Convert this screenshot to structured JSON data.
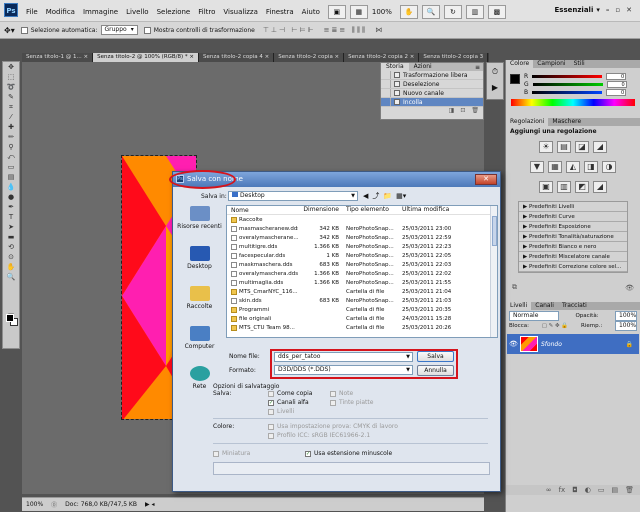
{
  "app": {
    "logo": "Ps",
    "menu": [
      "File",
      "Modifica",
      "Immagine",
      "Livello",
      "Selezione",
      "Filtro",
      "Visualizza",
      "Finestra",
      "Aiuto"
    ],
    "zoom": "100%",
    "workspace": "Essenziali",
    "window_controls": [
      "–",
      "▫",
      "✕"
    ]
  },
  "options_bar": {
    "auto_select_label": "Selezione automatica:",
    "auto_select_value": "Gruppo",
    "transform_label": "Mostra controlli di trasformazione"
  },
  "tabs": [
    {
      "label": "Senza titolo-1 @ 1... ×",
      "active": false
    },
    {
      "label": "Senza titolo-2 @ 100% (RGB/8) * ×",
      "active": true
    },
    {
      "label": "Senza titolo-2 copia 4 ×",
      "active": false
    },
    {
      "label": "Senza titolo-2 copia ×",
      "active": false
    },
    {
      "label": "Senza titolo-2 copia 2 ×",
      "active": false
    },
    {
      "label": "Senza titolo-2 copia 3",
      "active": false
    }
  ],
  "history_panel": {
    "tabs": [
      "Storia",
      "Azioni"
    ],
    "items": [
      {
        "label": "Trasformazione libera",
        "active": false
      },
      {
        "label": "Deselezione",
        "active": false
      },
      {
        "label": "Nuovo canale",
        "active": false
      },
      {
        "label": "Incolla",
        "active": true
      }
    ]
  },
  "color_panel": {
    "tabs": [
      "Colore",
      "Campioni",
      "Stili"
    ],
    "channels": [
      {
        "label": "R",
        "value": "0",
        "color": "#ff0000"
      },
      {
        "label": "G",
        "value": "0",
        "color": "#00c000"
      },
      {
        "label": "B",
        "value": "0",
        "color": "#0040ff"
      }
    ]
  },
  "adjustments_panel": {
    "tabs": [
      "Regolazioni",
      "Maschere"
    ],
    "title": "Aggiungi una regolazione",
    "icon_rows": [
      [
        "☀",
        "▤",
        "◪",
        "◢"
      ],
      [
        "▼",
        "▦",
        "◭",
        "◨",
        "◑"
      ],
      [
        "▣",
        "▥",
        "◩",
        "◢"
      ]
    ],
    "presets": [
      "Predefiniti Livelli",
      "Predefiniti Curve",
      "Predefiniti Esposizione",
      "Predefiniti Tonalità/saturazione",
      "Predefiniti Bianco e nero",
      "Predefiniti Miscelatore canale",
      "Predefiniti Correzione colore sel..."
    ]
  },
  "layers_panel": {
    "tabs": [
      "Livelli",
      "Canali",
      "Tracciati"
    ],
    "blend_mode": "Normale",
    "opacity_label": "Opacità:",
    "opacity": "100%",
    "lock_label": "Blocca:",
    "fill_label": "Riemp.:",
    "fill": "100%",
    "layers": [
      {
        "name": "Sfondo",
        "visible": true
      }
    ],
    "footer_icons": [
      "∞",
      "fx",
      "◘",
      "◐",
      "▭",
      "▤",
      "🗑"
    ]
  },
  "statusbar": {
    "zoom": "100%",
    "doc": "Doc: 768,0 KB/747,5 KB"
  },
  "dialog": {
    "title": "Salva con nome",
    "save_in_label": "Salva in:",
    "save_in_value": "Desktop",
    "places": [
      "Risorse recenti",
      "Desktop",
      "Raccolte",
      "Computer",
      "Rete"
    ],
    "columns": [
      "Nome",
      "Dimensione",
      "Tipo elemento",
      "Ultima modifica"
    ],
    "files": [
      {
        "name": "Raccolte",
        "size": "",
        "type": "",
        "date": "",
        "folder": true
      },
      {
        "name": "masmascheranew.dds",
        "size": "342 KB",
        "type": "NeroPhotoSnap...",
        "date": "25/03/2011 23:00",
        "folder": false
      },
      {
        "name": "overalymascherane...",
        "size": "342 KB",
        "type": "NeroPhotoSnap...",
        "date": "25/03/2011 22:59",
        "folder": false
      },
      {
        "name": "multitigre.dds",
        "size": "1.366 KB",
        "type": "NeroPhotoSnap...",
        "date": "25/03/2011 22:23",
        "folder": false
      },
      {
        "name": "facespecular.dds",
        "size": "1 KB",
        "type": "NeroPhotoSnap...",
        "date": "25/03/2011 22:05",
        "folder": false
      },
      {
        "name": "maskmaschera.dds",
        "size": "683 KB",
        "type": "NeroPhotoSnap...",
        "date": "25/03/2011 22:03",
        "folder": false
      },
      {
        "name": "overalymaschera.dds",
        "size": "1.366 KB",
        "type": "NeroPhotoSnap...",
        "date": "25/03/2011 22:02",
        "folder": false
      },
      {
        "name": "multimaglia.dds",
        "size": "1.366 KB",
        "type": "NeroPhotoSnap...",
        "date": "25/03/2011 21:55",
        "folder": false
      },
      {
        "name": "MTS_CmarNYC_116...",
        "size": "",
        "type": "Cartella di file",
        "date": "25/03/2011 21:04",
        "folder": true
      },
      {
        "name": "skin.dds",
        "size": "683 KB",
        "type": "NeroPhotoSnap...",
        "date": "25/03/2011 21:03",
        "folder": false
      },
      {
        "name": "Programmi",
        "size": "",
        "type": "Cartella di file",
        "date": "25/03/2011 20:35",
        "folder": true
      },
      {
        "name": "file originali",
        "size": "",
        "type": "Cartella di file",
        "date": "24/03/2011 15:28",
        "folder": true
      },
      {
        "name": "MTS_CTU Team 98...",
        "size": "",
        "type": "Cartella di file",
        "date": "25/03/2011 20:26",
        "folder": true
      }
    ],
    "filename_label": "Nome file:",
    "filename_value": "dds_per_tatoo",
    "format_label": "Formato:",
    "format_value": "D3D/DDS (*.DDS)",
    "save_button": "Salva",
    "cancel_button": "Annulla",
    "save_options_title": "Opzioni di salvataggio",
    "save_label": "Salva:",
    "as_copy": "Come copia",
    "notes": "Note",
    "alpha": "Canali alfa",
    "spot": "Tinte piatte",
    "layers": "Livelli",
    "color_label": "Colore:",
    "proof": "Usa impostazione prova:  CMYK di lavoro",
    "icc": "Profilo ICC:  sRGB IEC61966-2.1",
    "thumbnail": "Miniatura",
    "lowercase_ext": "Usa estensione minuscole",
    "accent": "#d5141c"
  }
}
